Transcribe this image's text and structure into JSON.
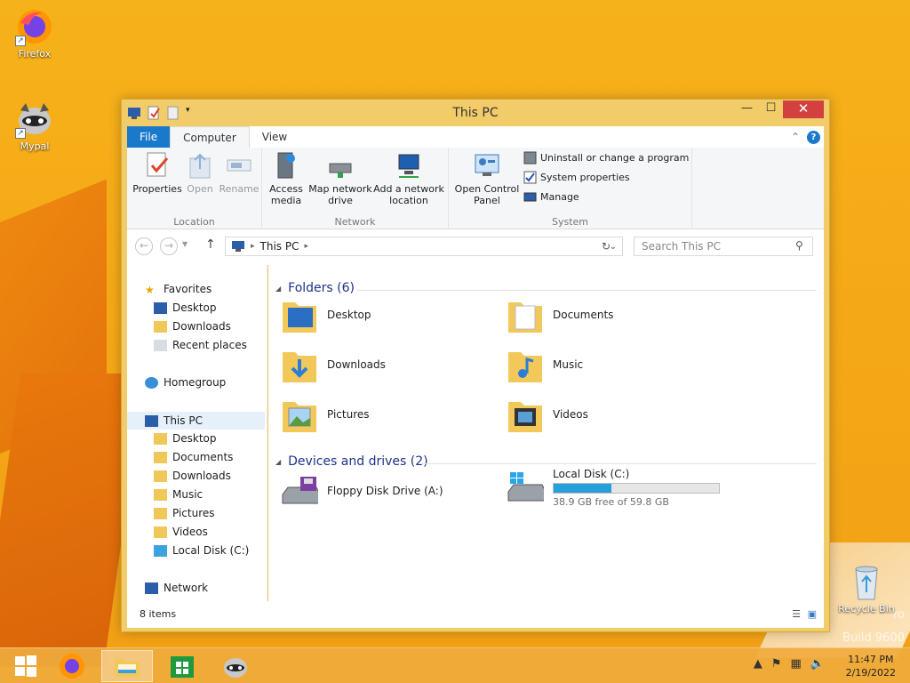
{
  "desktop": {
    "icons": [
      {
        "label": "Firefox"
      },
      {
        "label": "Mypal"
      },
      {
        "label": "Recycle Bin"
      }
    ],
    "watermark_line1": "ro",
    "watermark_line2": "Build 9600"
  },
  "window": {
    "title": "This PC",
    "controls": {
      "minimize": "—",
      "maximize": "☐",
      "close": "✕"
    }
  },
  "ribbon": {
    "tabs": [
      "File",
      "Computer",
      "View"
    ],
    "active_tab": "Computer",
    "groups": {
      "location": {
        "label": "Location",
        "buttons": [
          {
            "label": "Properties",
            "icon": "properties-icon"
          },
          {
            "label": "Open",
            "icon": "open-icon"
          },
          {
            "label": "Rename",
            "icon": "rename-icon"
          }
        ]
      },
      "network": {
        "label": "Network",
        "buttons": [
          {
            "label": "Access media",
            "icon": "access-media-icon"
          },
          {
            "label": "Map network drive",
            "icon": "map-drive-icon"
          },
          {
            "label": "Add a network location",
            "icon": "add-location-icon"
          }
        ]
      },
      "system": {
        "label": "System",
        "open_control_panel": "Open Control Panel",
        "items": [
          "Uninstall or change a program",
          "System properties",
          "Manage"
        ]
      }
    }
  },
  "address": {
    "path": "This PC",
    "search_placeholder": "Search This PC"
  },
  "navpane": {
    "favorites": "Favorites",
    "fav_items": [
      "Desktop",
      "Downloads",
      "Recent places"
    ],
    "homegroup": "Homegroup",
    "this_pc": "This PC",
    "pc_items": [
      "Desktop",
      "Documents",
      "Downloads",
      "Music",
      "Pictures",
      "Videos",
      "Local Disk (C:)"
    ],
    "network": "Network"
  },
  "content": {
    "folders_header": "Folders (6)",
    "folders": [
      "Desktop",
      "Documents",
      "Downloads",
      "Music",
      "Pictures",
      "Videos"
    ],
    "devices_header": "Devices and drives (2)",
    "floppy": "Floppy Disk Drive (A:)",
    "local_disk": {
      "name": "Local Disk (C:)",
      "free_text": "38.9 GB free of 59.8 GB",
      "used_fraction": 0.35
    }
  },
  "status": {
    "items": "8 items"
  },
  "taskbar": {
    "time": "11:47 PM",
    "date": "2/19/2022"
  }
}
